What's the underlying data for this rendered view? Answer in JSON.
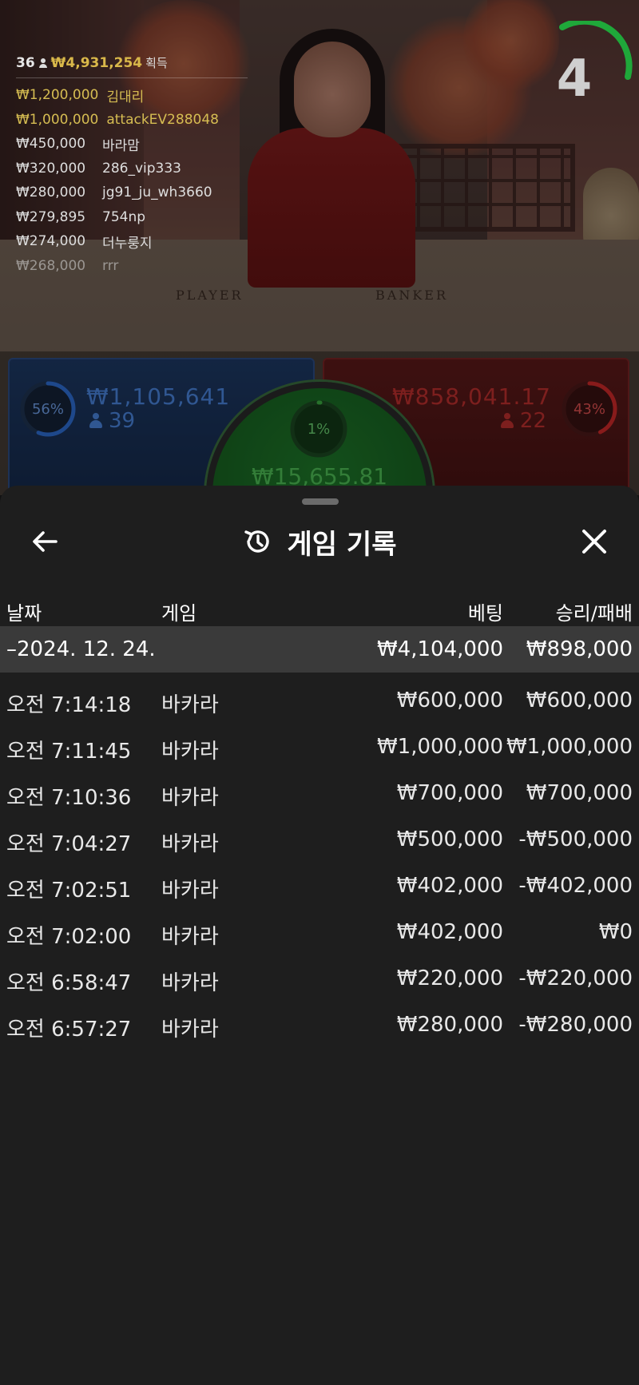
{
  "live": {
    "leaderboard": {
      "player_count": "36",
      "total": "₩4,931,254",
      "total_label": "획득",
      "rows": [
        {
          "amount": "₩1,200,000",
          "name": "김대리"
        },
        {
          "amount": "₩1,000,000",
          "name": "attackEV288048"
        },
        {
          "amount": "₩450,000",
          "name": "바라맘"
        },
        {
          "amount": "₩320,000",
          "name": "286_vip333"
        },
        {
          "amount": "₩280,000",
          "name": "jg91_ju_wh3660"
        },
        {
          "amount": "₩279,895",
          "name": "754np"
        },
        {
          "amount": "₩274,000",
          "name": "더누룽지"
        },
        {
          "amount": "₩268,000",
          "name": "rrr"
        }
      ]
    },
    "countdown": "4",
    "table_labels": {
      "player": "PLAYER",
      "banker": "BANKER"
    },
    "player_bet": {
      "percent": "56%",
      "percent_value": 0.56,
      "amount": "₩1,105,641",
      "count": "39"
    },
    "banker_bet": {
      "percent": "43%",
      "percent_value": 0.43,
      "amount": "₩858,041.17",
      "count": "22"
    },
    "tie_bet": {
      "percent": "1%",
      "percent_value": 0.01,
      "amount": "₩15,655.81"
    },
    "colors": {
      "player": "#2f6fd6",
      "banker": "#d12a2a",
      "tie": "#3cb043",
      "gold": "#d6bd52"
    }
  },
  "sheet": {
    "title": "게임 기록",
    "columns": {
      "date": "날짜",
      "game": "게임",
      "bet": "베팅",
      "result": "승리/패배"
    },
    "date_group": {
      "date": "–2024. 12. 24.",
      "bet": "₩4,104,000",
      "result": "₩898,000"
    },
    "rows": [
      {
        "time": "오전 7:14:18",
        "game": "바카라",
        "bet": "₩600,000",
        "result": "₩600,000"
      },
      {
        "time": "오전 7:11:45",
        "game": "바카라",
        "bet": "₩1,000,000",
        "result": "₩1,000,000"
      },
      {
        "time": "오전 7:10:36",
        "game": "바카라",
        "bet": "₩700,000",
        "result": "₩700,000"
      },
      {
        "time": "오전 7:04:27",
        "game": "바카라",
        "bet": "₩500,000",
        "result": "-₩500,000"
      },
      {
        "time": "오전 7:02:51",
        "game": "바카라",
        "bet": "₩402,000",
        "result": "-₩402,000"
      },
      {
        "time": "오전 7:02:00",
        "game": "바카라",
        "bet": "₩402,000",
        "result": "₩0"
      },
      {
        "time": "오전 6:58:47",
        "game": "바카라",
        "bet": "₩220,000",
        "result": "-₩220,000"
      },
      {
        "time": "오전 6:57:27",
        "game": "바카라",
        "bet": "₩280,000",
        "result": "-₩280,000"
      }
    ]
  }
}
